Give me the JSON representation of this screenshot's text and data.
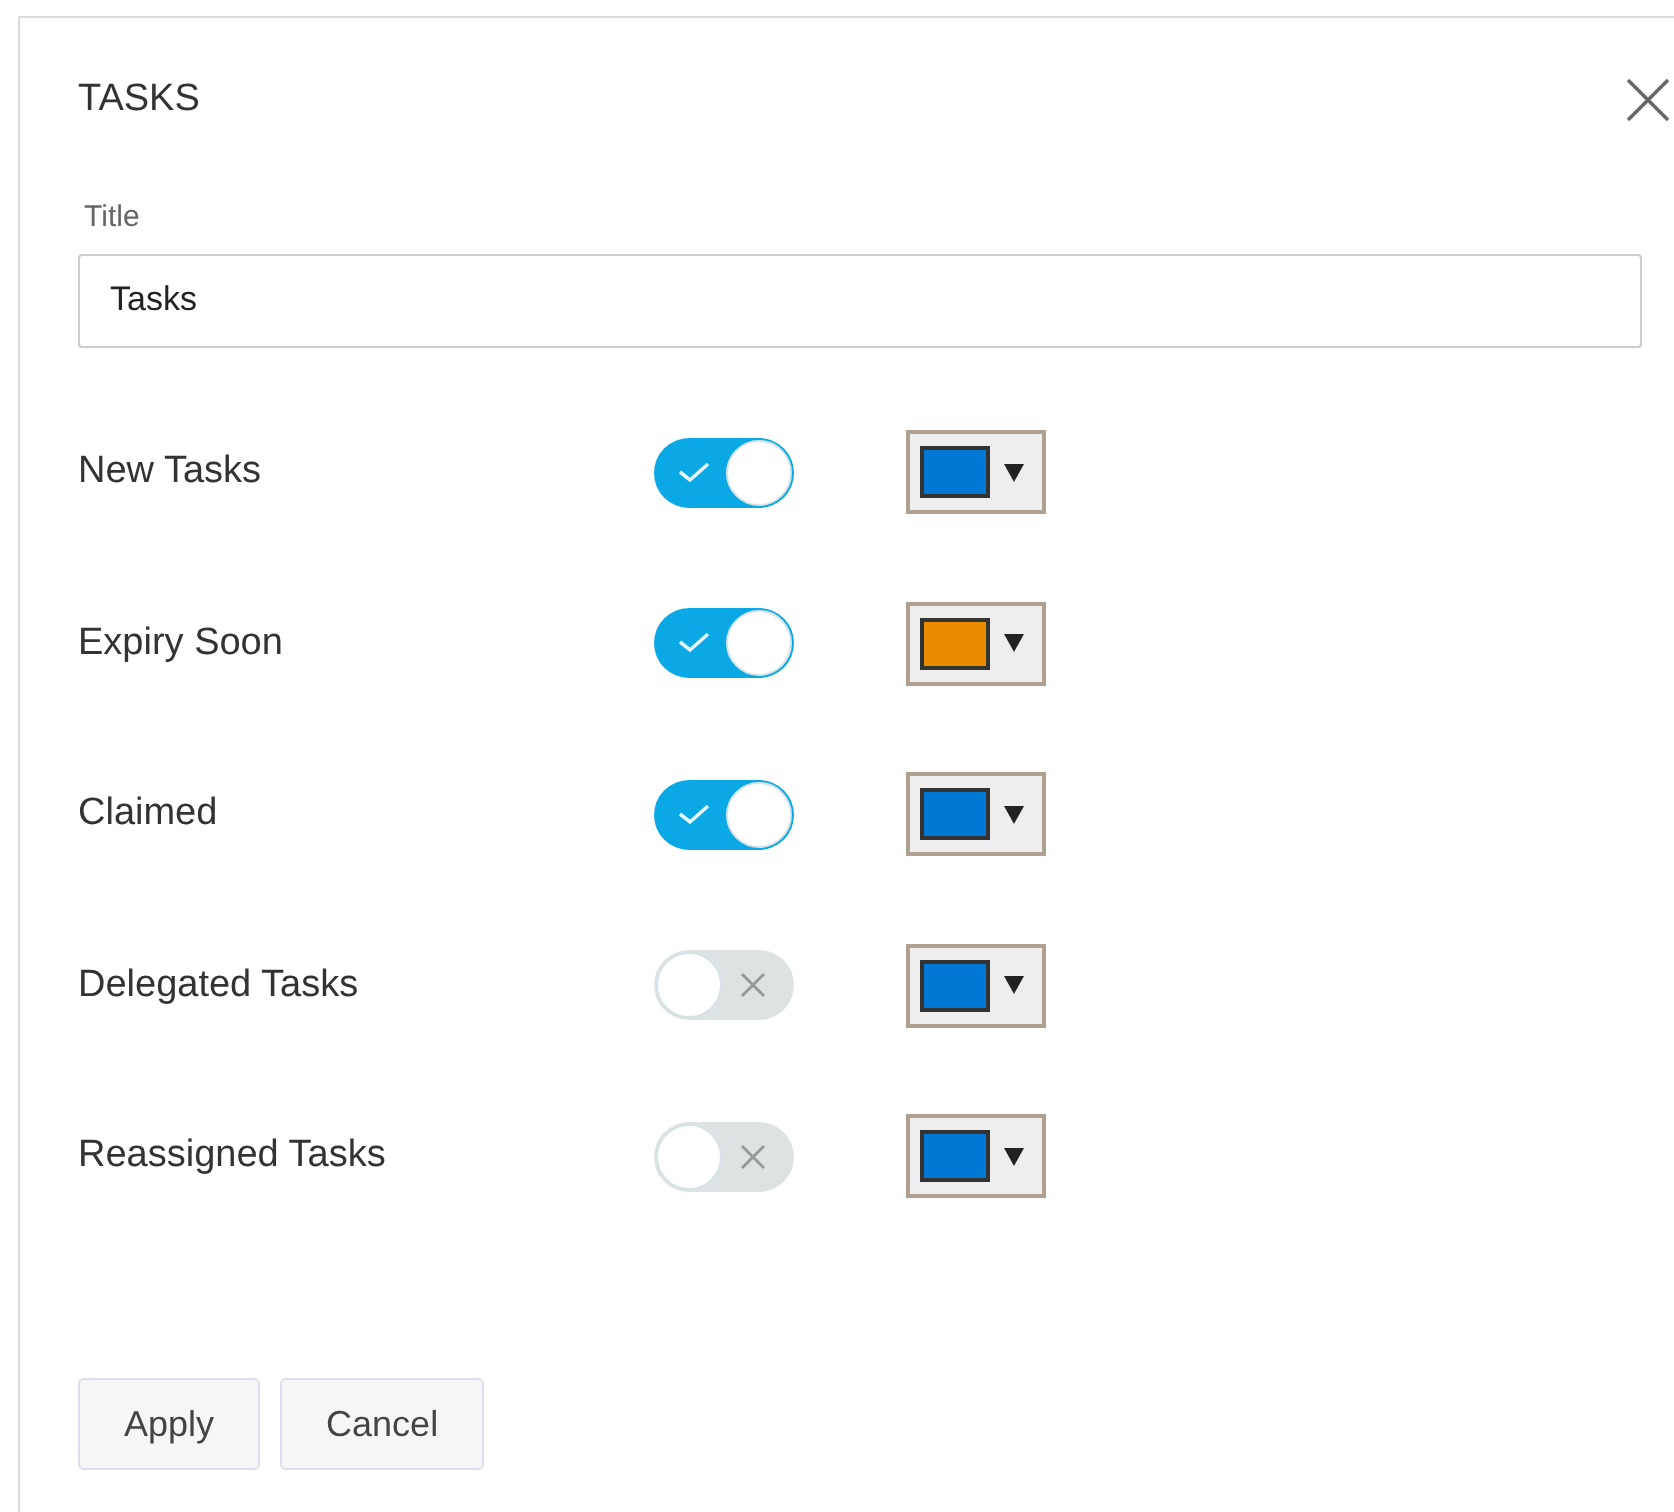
{
  "dialog": {
    "title": "TASKS"
  },
  "title_field": {
    "label": "Title",
    "value": "Tasks"
  },
  "rows": [
    {
      "label": "New Tasks",
      "on": true,
      "color": "#0078d4"
    },
    {
      "label": "Expiry Soon",
      "on": true,
      "color": "#ea8c00"
    },
    {
      "label": "Claimed",
      "on": true,
      "color": "#0078d4"
    },
    {
      "label": "Delegated Tasks",
      "on": false,
      "color": "#0078d4"
    },
    {
      "label": "Reassigned Tasks",
      "on": false,
      "color": "#0078d4"
    }
  ],
  "buttons": [
    "Apply",
    "Cancel"
  ]
}
